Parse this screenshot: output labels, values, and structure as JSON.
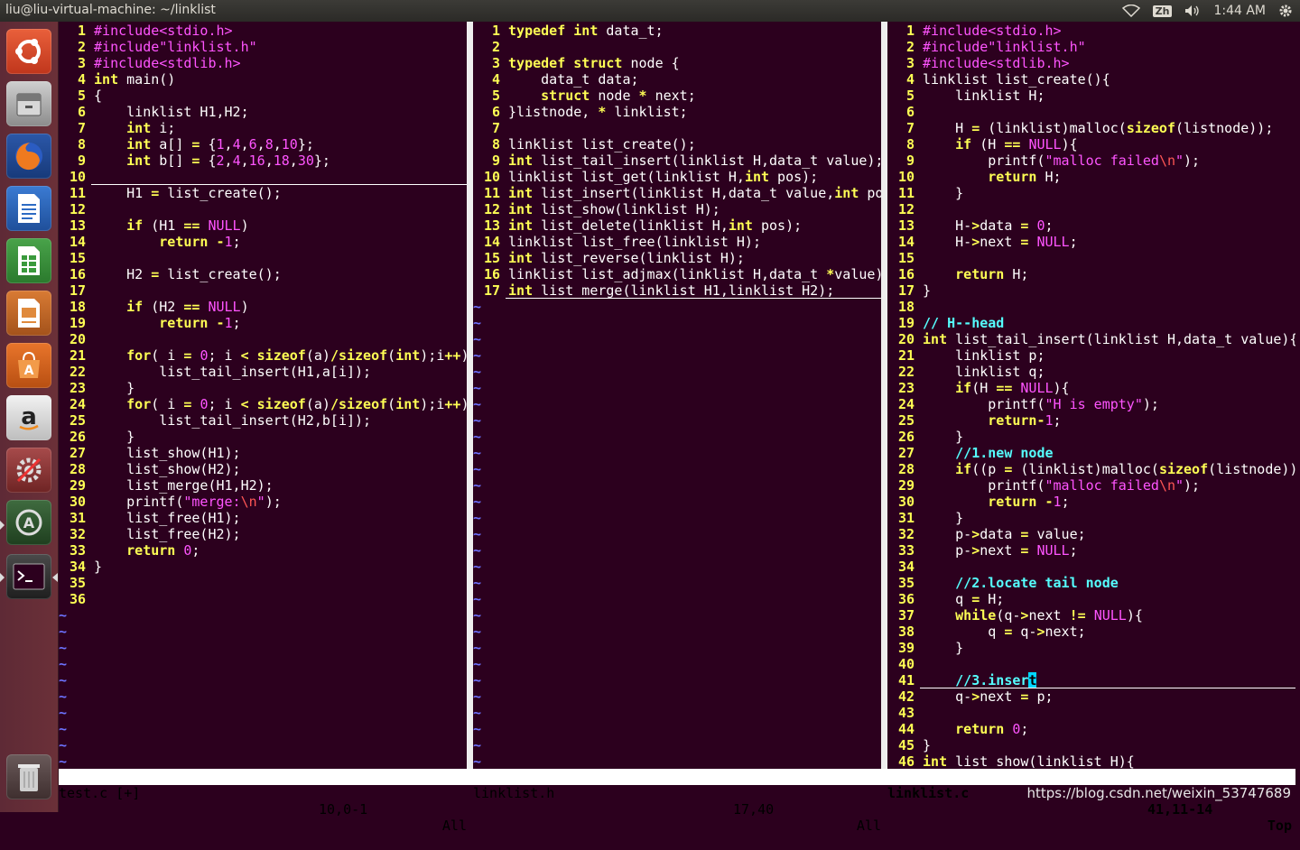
{
  "window_title": "liu@liu-virtual-machine: ~/linklist",
  "indicators": {
    "input_method": "Zh",
    "clock": "1:44 AM"
  },
  "launcher_apps": [
    "dash-home",
    "files",
    "firefox",
    "writer",
    "calc",
    "impress",
    "software-center",
    "amazon",
    "settings",
    "updater",
    "terminal",
    "trash"
  ],
  "panes": {
    "left": {
      "lines": [
        {
          "n": "1",
          "t": "#include<stdio.h>"
        },
        {
          "n": "2",
          "t": "#include\"linklist.h\""
        },
        {
          "n": "3",
          "t": "#include<stdlib.h>"
        },
        {
          "n": "4",
          "t": "int main()"
        },
        {
          "n": "5",
          "t": "{"
        },
        {
          "n": "6",
          "t": "    linklist H1,H2;"
        },
        {
          "n": "7",
          "t": "    int i;"
        },
        {
          "n": "8",
          "t": "    int a[] = {1,4,6,8,10};"
        },
        {
          "n": "9",
          "t": "    int b[] = {2,4,16,18,30};"
        },
        {
          "n": "10",
          "t": ""
        },
        {
          "n": "11",
          "t": "    H1 = list_create();"
        },
        {
          "n": "12",
          "t": ""
        },
        {
          "n": "13",
          "t": "    if (H1 == NULL)"
        },
        {
          "n": "14",
          "t": "        return -1;"
        },
        {
          "n": "15",
          "t": ""
        },
        {
          "n": "16",
          "t": "    H2 = list_create();"
        },
        {
          "n": "17",
          "t": ""
        },
        {
          "n": "18",
          "t": "    if (H2 == NULL)"
        },
        {
          "n": "19",
          "t": "        return -1;"
        },
        {
          "n": "20",
          "t": ""
        },
        {
          "n": "21",
          "t": "    for( i = 0; i < sizeof(a)/sizeof(int);i++)"
        },
        {
          "n": "22",
          "t": "        list_tail_insert(H1,a[i]);"
        },
        {
          "n": "23",
          "t": "    }"
        },
        {
          "n": "24",
          "t": "    for( i = 0; i < sizeof(a)/sizeof(int);i++)"
        },
        {
          "n": "25",
          "t": "        list_tail_insert(H2,b[i]);"
        },
        {
          "n": "26",
          "t": "    }"
        },
        {
          "n": "27",
          "t": "    list_show(H1);"
        },
        {
          "n": "28",
          "t": "    list_show(H2);"
        },
        {
          "n": "29",
          "t": "    list_merge(H1,H2);"
        },
        {
          "n": "30",
          "t": "    printf(\"merge:\\n\");"
        },
        {
          "n": "31",
          "t": "    list_free(H1);"
        },
        {
          "n": "32",
          "t": "    list_free(H2);"
        },
        {
          "n": "33",
          "t": "    return 0;"
        },
        {
          "n": "34",
          "t": "}"
        },
        {
          "n": "35",
          "t": ""
        },
        {
          "n": "36",
          "t": ""
        }
      ],
      "status": {
        "file": "test.c [+]",
        "pos": "10,0-1",
        "scroll": "All"
      }
    },
    "middle": {
      "lines": [
        {
          "n": "1",
          "t": "typedef int data_t;"
        },
        {
          "n": "2",
          "t": ""
        },
        {
          "n": "3",
          "t": "typedef struct node {"
        },
        {
          "n": "4",
          "t": "    data_t data;"
        },
        {
          "n": "5",
          "t": "    struct node * next;"
        },
        {
          "n": "6",
          "t": "}listnode, * linklist;"
        },
        {
          "n": "7",
          "t": ""
        },
        {
          "n": "8",
          "t": "linklist list_create();"
        },
        {
          "n": "9",
          "t": "int list_tail_insert(linklist H,data_t value);"
        },
        {
          "n": "10",
          "t": "linklist list_get(linklist H,int pos);"
        },
        {
          "n": "11",
          "t": "int list_insert(linklist H,data_t value,int po"
        },
        {
          "n": "12",
          "t": "int list_show(linklist H);"
        },
        {
          "n": "13",
          "t": "int list_delete(linklist H,int pos);"
        },
        {
          "n": "14",
          "t": "linklist list_free(linklist H);"
        },
        {
          "n": "15",
          "t": "int list_reverse(linklist H);"
        },
        {
          "n": "16",
          "t": "linklist list_adjmax(linklist H,data_t *value)"
        },
        {
          "n": "17",
          "t": "int list_merge(linklist H1,linklist H2);"
        }
      ],
      "status": {
        "file": "linklist.h",
        "pos": "17,40",
        "scroll": "All"
      }
    },
    "right": {
      "lines": [
        {
          "n": "1",
          "t": "#include<stdio.h>"
        },
        {
          "n": "2",
          "t": "#include\"linklist.h\""
        },
        {
          "n": "3",
          "t": "#include<stdlib.h>"
        },
        {
          "n": "4",
          "t": "linklist list_create(){"
        },
        {
          "n": "5",
          "t": "    linklist H;"
        },
        {
          "n": "6",
          "t": ""
        },
        {
          "n": "7",
          "t": "    H = (linklist)malloc(sizeof(listnode));"
        },
        {
          "n": "8",
          "t": "    if (H == NULL){"
        },
        {
          "n": "9",
          "t": "        printf(\"malloc failed\\n\");"
        },
        {
          "n": "10",
          "t": "        return H;"
        },
        {
          "n": "11",
          "t": "    }"
        },
        {
          "n": "12",
          "t": ""
        },
        {
          "n": "13",
          "t": "    H->data = 0;"
        },
        {
          "n": "14",
          "t": "    H->next = NULL;"
        },
        {
          "n": "15",
          "t": ""
        },
        {
          "n": "16",
          "t": "    return H;"
        },
        {
          "n": "17",
          "t": "}"
        },
        {
          "n": "18",
          "t": ""
        },
        {
          "n": "19",
          "t": "// H--head"
        },
        {
          "n": "20",
          "t": "int list_tail_insert(linklist H,data_t value){"
        },
        {
          "n": "21",
          "t": "    linklist p;"
        },
        {
          "n": "22",
          "t": "    linklist q;"
        },
        {
          "n": "23",
          "t": "    if(H == NULL){"
        },
        {
          "n": "24",
          "t": "        printf(\"H is empty\");"
        },
        {
          "n": "25",
          "t": "        return-1;"
        },
        {
          "n": "26",
          "t": "    }"
        },
        {
          "n": "27",
          "t": "    //1.new node"
        },
        {
          "n": "28",
          "t": "    if((p = (linklist)malloc(sizeof(listnode))"
        },
        {
          "n": "29",
          "t": "        printf(\"malloc failed\\n\");"
        },
        {
          "n": "30",
          "t": "        return -1;"
        },
        {
          "n": "31",
          "t": "    }"
        },
        {
          "n": "32",
          "t": "    p->data = value;"
        },
        {
          "n": "33",
          "t": "    p->next = NULL;"
        },
        {
          "n": "34",
          "t": ""
        },
        {
          "n": "35",
          "t": "    //2.locate tail node"
        },
        {
          "n": "36",
          "t": "    q = H;"
        },
        {
          "n": "37",
          "t": "    while(q->next != NULL){"
        },
        {
          "n": "38",
          "t": "        q = q->next;"
        },
        {
          "n": "39",
          "t": "    }"
        },
        {
          "n": "40",
          "t": ""
        },
        {
          "n": "41",
          "t": "    //3.insert"
        },
        {
          "n": "42",
          "t": "    q->next = p;"
        },
        {
          "n": "43",
          "t": ""
        },
        {
          "n": "44",
          "t": "    return 0;"
        },
        {
          "n": "45",
          "t": "}"
        },
        {
          "n": "46",
          "t": "int list_show(linklist H){"
        }
      ],
      "status": {
        "file": "linklist.c",
        "pos": "41,11-14",
        "scroll": "Top"
      }
    }
  },
  "watermark": "https://blog.csdn.net/weixin_53747689"
}
